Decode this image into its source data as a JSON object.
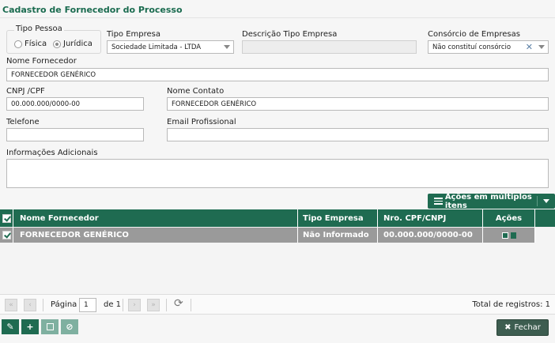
{
  "title": "Cadastro de Fornecedor do Processo",
  "tipo_pessoa": {
    "legend": "Tipo Pessoa",
    "options": [
      {
        "label": "Física",
        "selected": false
      },
      {
        "label": "Jurídica",
        "selected": true
      }
    ]
  },
  "tipo_empresa": {
    "label": "Tipo Empresa",
    "value": "Sociedade Limitada - LTDA"
  },
  "descricao_tipo_empresa": {
    "label": "Descrição Tipo Empresa",
    "value": ""
  },
  "consorcio": {
    "label": "Consórcio de Empresas",
    "value": "Não constituí consórcio",
    "clear_icon": "close-icon"
  },
  "nome_fornecedor": {
    "label": "Nome Fornecedor",
    "value": "FORNECEDOR GENÉRICO"
  },
  "cnpj": {
    "label": "CNPJ /CPF",
    "value": "00.000.000/0000-00"
  },
  "nome_contato": {
    "label": "Nome Contato",
    "value": "FORNECEDOR GENÉRICO"
  },
  "telefone": {
    "label": "Telefone",
    "value": ""
  },
  "email": {
    "label": "Email Profissional",
    "value": ""
  },
  "informacoes": {
    "label": "Informações Adicionais",
    "value": ""
  },
  "multi_actions": {
    "label": "Ações em múltiplos itens",
    "icon": "menu-icon"
  },
  "grid": {
    "columns": [
      "Nome Fornecedor",
      "Tipo Empresa",
      "Nro. CPF/CNPJ",
      "Ações"
    ],
    "rows": [
      {
        "nome": "FORNECEDOR GENÉRICO",
        "tipo": "Não Informado",
        "nro": "00.000.000/0000-00",
        "checked": true
      }
    ]
  },
  "pager": {
    "page_label": "Página",
    "page_value": "1",
    "of_label": "de 1",
    "total": "Total de registros: 1"
  },
  "footer": {
    "buttons": [
      "edit-icon",
      "plus-icon",
      "save-icon",
      "cancel-icon"
    ],
    "close_label": "Fechar"
  },
  "colors": {
    "accent": "#1f6b51",
    "title": "#1a6b4f",
    "row": "#9a9a9a"
  }
}
